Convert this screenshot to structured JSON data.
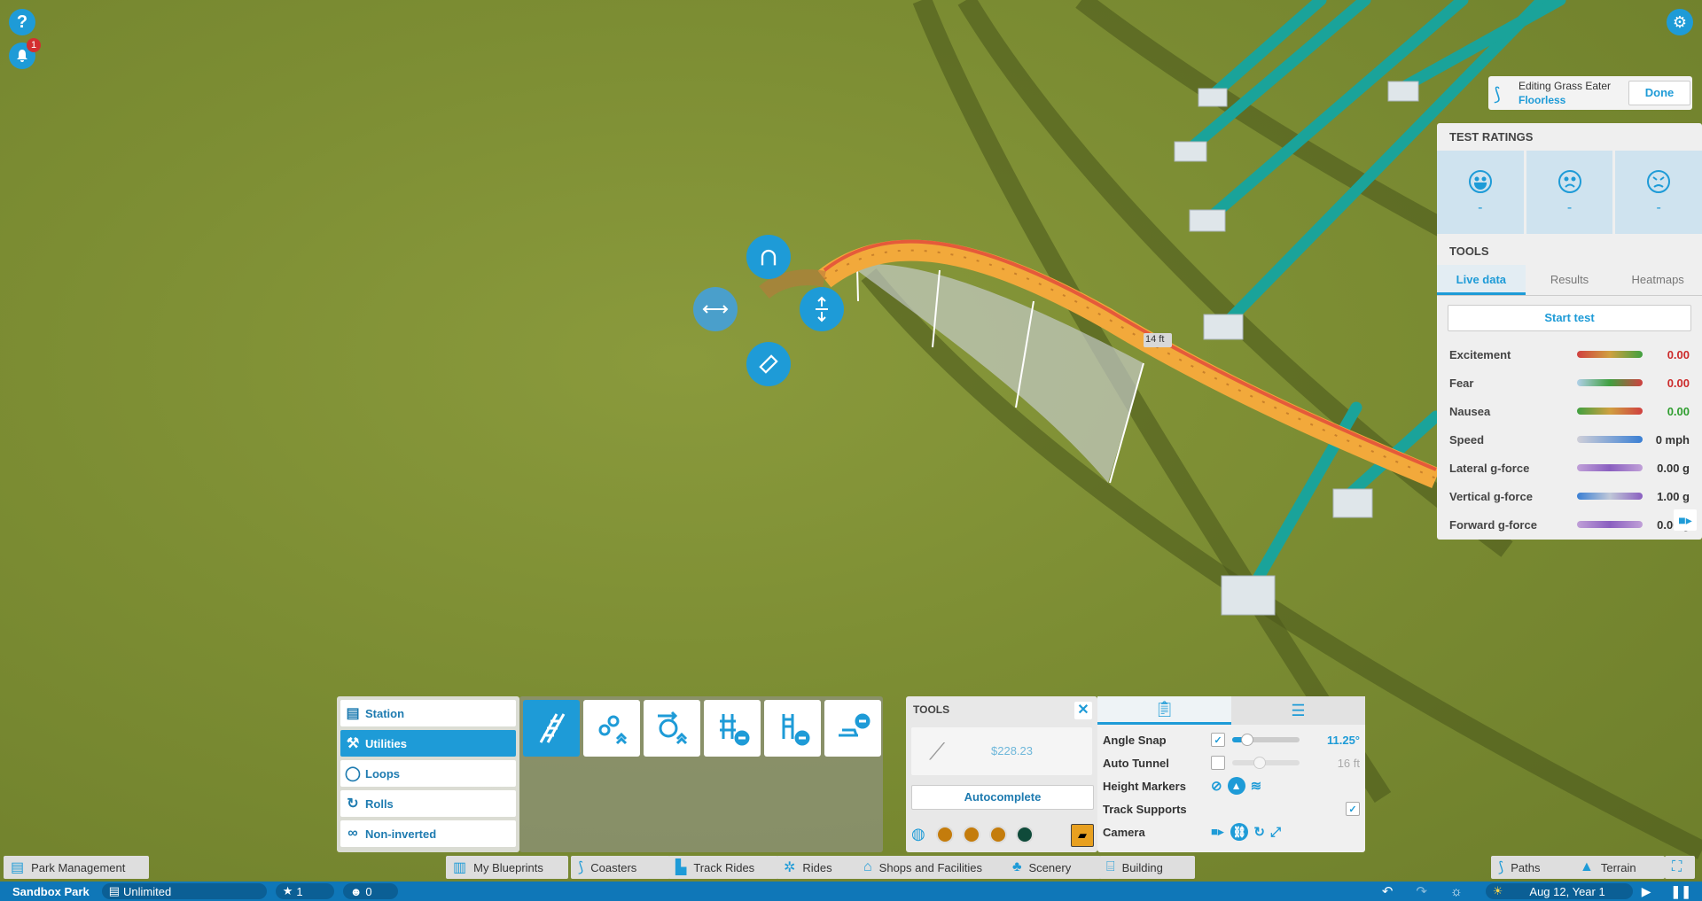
{
  "editing": {
    "label": "Editing Grass Eater",
    "ride_type": "Floorless",
    "done_label": "Done"
  },
  "notifications": {
    "count": "1"
  },
  "track_marker": "14 ft",
  "test_ratings": {
    "header": "TEST RATINGS",
    "faces": [
      {
        "name": "excitement-face-icon",
        "value": "-"
      },
      {
        "name": "fear-face-icon",
        "value": "-"
      },
      {
        "name": "nausea-face-icon",
        "value": "-"
      }
    ],
    "tools_header": "TOOLS",
    "tabs": [
      "Live data",
      "Results",
      "Heatmaps"
    ],
    "start_test": "Start test",
    "stats": [
      {
        "label": "Excitement",
        "value": "0.00",
        "color": "#cc2b2b"
      },
      {
        "label": "Fear",
        "value": "0.00",
        "color": "#cc2b2b"
      },
      {
        "label": "Nausea",
        "value": "0.00",
        "color": "#2f9e2f"
      },
      {
        "label": "Speed",
        "value": "0 mph",
        "color": "#555555"
      },
      {
        "label": "Lateral g-force",
        "value": "0.00 g",
        "color": "#555555"
      },
      {
        "label": "Vertical g-force",
        "value": "1.00 g",
        "color": "#555555"
      },
      {
        "label": "Forward g-force",
        "value": "0.00 g",
        "color": "#555555"
      }
    ]
  },
  "categories": [
    "Station",
    "Utilities",
    "Loops",
    "Rolls",
    "Non-inverted"
  ],
  "pieces": [
    "straight-track-icon",
    "chain-lift-icon",
    "booster-icon",
    "remove-brake-icon",
    "remove-block-brake-icon",
    "remove-station-icon"
  ],
  "tools": {
    "header": "TOOLS",
    "cost": "$228.23",
    "autocomplete": "Autocomplete"
  },
  "options": {
    "angle_snap": {
      "label": "Angle Snap",
      "value": "11.25°",
      "checked": true
    },
    "auto_tunnel": {
      "label": "Auto Tunnel",
      "value": "16 ft",
      "checked": false
    },
    "height_markers": {
      "label": "Height Markers"
    },
    "track_supports": {
      "label": "Track Supports",
      "checked": true
    },
    "camera": {
      "label": "Camera"
    }
  },
  "menu": {
    "park_management": "Park Management",
    "my_blueprints": "My Blueprints",
    "coasters": "Coasters",
    "track_rides": "Track Rides",
    "rides": "Rides",
    "shops": "Shops and Facilities",
    "scenery": "Scenery",
    "building": "Building",
    "paths": "Paths",
    "terrain": "Terrain"
  },
  "status": {
    "park_name": "Sandbox Park",
    "money": "Unlimited",
    "rating": "1",
    "guests": "0",
    "date": "Aug 12, Year 1"
  },
  "colors": {
    "accent": "#1e9bd7",
    "track": "#f2a93b",
    "supports": "#1aa39a",
    "grass": "#7c8d33"
  }
}
